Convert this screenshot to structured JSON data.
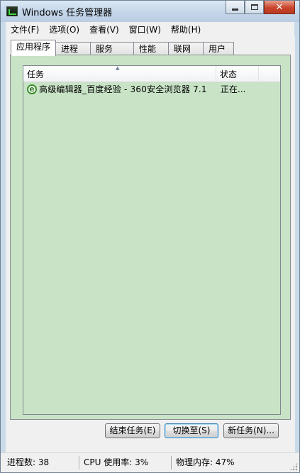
{
  "window": {
    "title": "Windows 任务管理器",
    "icon": "task-manager-icon"
  },
  "caption_buttons": {
    "minimize": "minimize-icon",
    "maximize": "maximize-icon",
    "close": "✕"
  },
  "menu": {
    "items": [
      {
        "label": "文件(F)"
      },
      {
        "label": "选项(O)"
      },
      {
        "label": "查看(V)"
      },
      {
        "label": "窗口(W)"
      },
      {
        "label": "帮助(H)"
      }
    ]
  },
  "tabs": [
    {
      "label": "应用程序",
      "active": true
    },
    {
      "label": "进程",
      "active": false
    },
    {
      "label": "服务",
      "active": false
    },
    {
      "label": "性能",
      "active": false
    },
    {
      "label": "联网",
      "active": false
    },
    {
      "label": "用户",
      "active": false
    }
  ],
  "task_list": {
    "columns": [
      {
        "label": "任务"
      },
      {
        "label": "状态"
      }
    ],
    "sort_indicator": "▲",
    "rows": [
      {
        "icon": "e",
        "task": "高级编辑器_百度经验 - 360安全浏览器 7.1",
        "status": "正在..."
      }
    ]
  },
  "buttons": {
    "end_task": "结束任务(E)",
    "switch_to": "切换至(S)",
    "new_task": "新任务(N)..."
  },
  "status_bar": {
    "processes": "进程数: 38",
    "cpu": "CPU 使用率: 3%",
    "memory": "物理内存: 47%"
  },
  "colors": {
    "panel_background": "#c8e3c6",
    "title_bar": "#c5d7ea",
    "close_button": "#c8452c"
  }
}
